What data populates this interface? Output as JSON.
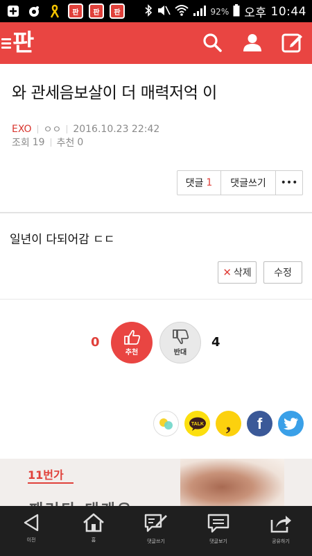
{
  "status_bar": {
    "app_badge": "판",
    "battery": "92%",
    "time_prefix": "오후",
    "time": "10:44"
  },
  "header": {
    "logo": "판",
    "icons": [
      "search-icon",
      "person-icon",
      "compose-icon"
    ]
  },
  "post": {
    "title": "와 관세음보살이 더 매력저억 이",
    "author": "EXO",
    "author_sub": "ㅇㅇ",
    "date": "2016.10.23 22:42",
    "views_label": "조회",
    "views": "19",
    "recommend_label": "추천",
    "recommend": "0",
    "body": "일년이 다되어감 ㄷㄷ"
  },
  "comment_bar": {
    "comments_label": "댓글",
    "comments_count": "1",
    "write_label": "댓글쓰기",
    "more_label": "•••"
  },
  "edit": {
    "delete_label": "삭제",
    "modify_label": "수정"
  },
  "votes": {
    "up_count": "0",
    "up_label": "추천",
    "down_count": "4",
    "down_label": "반대"
  },
  "share": {
    "icons": [
      "band-icon",
      "kakaotalk-icon",
      "kakaostory-icon",
      "facebook-icon",
      "twitter-icon"
    ],
    "talk_label": "TALK",
    "story_label": ",",
    "fb_label": "f"
  },
  "ad": {
    "logo": "11번가",
    "text": "패러다 대개요"
  },
  "bottom_nav": [
    {
      "label": "이전",
      "icon": "back-icon"
    },
    {
      "label": "홈",
      "icon": "home-icon"
    },
    {
      "label": "댓글쓰기",
      "icon": "write-comment-icon"
    },
    {
      "label": "댓글보기",
      "icon": "view-comments-icon"
    },
    {
      "label": "공유하기",
      "icon": "share-icon"
    }
  ],
  "colors": {
    "brand": "#e94542",
    "accent_red": "#e0403a",
    "nav_bg": "#1f1f1f"
  }
}
